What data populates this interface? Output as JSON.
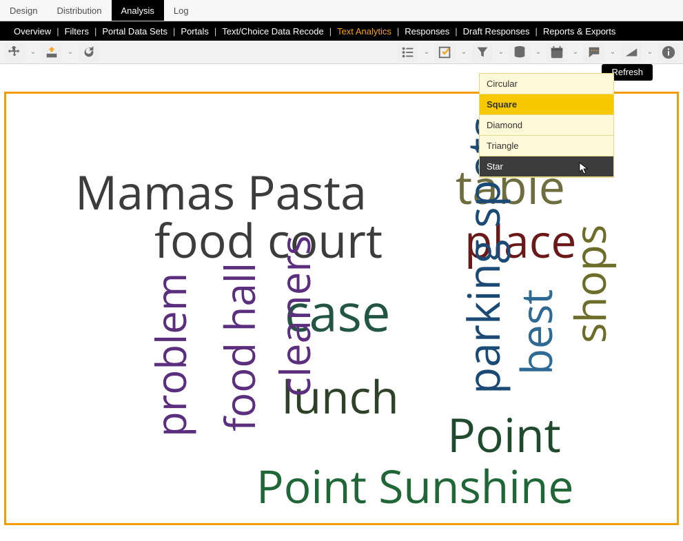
{
  "top_tabs": {
    "design": "Design",
    "distribution": "Distribution",
    "analysis": "Analysis",
    "log": "Log",
    "active": "analysis"
  },
  "subnav": {
    "overview": "Overview",
    "filters": "Filters",
    "pds": "Portal Data Sets",
    "portals": "Portals",
    "recode": "Text/Choice Data Recode",
    "ta": "Text Analytics",
    "responses": "Responses",
    "drafts": "Draft Responses",
    "reports": "Reports & Exports",
    "active": "ta"
  },
  "refresh": "Refresh",
  "shape_menu": {
    "circular": "Circular",
    "square": "Square",
    "diamond": "Diamond",
    "triangle": "Triangle",
    "star": "Star"
  },
  "toolbar_icons": {
    "move": "move-icon",
    "export": "export-icon",
    "refresh": "refresh-icon",
    "list": "list-icon",
    "check": "check-icon",
    "funnel": "funnel-icon",
    "database": "database-icon",
    "calendar": "calendar-icon",
    "chat": "chat-icon",
    "slope": "slope-icon",
    "info": "info-icon"
  },
  "wordcloud": {
    "mamas_pasta": "Mamas Pasta",
    "table": "table",
    "food_court": "food court",
    "place": "place",
    "case": "case",
    "lunch": "lunch",
    "point": "Point",
    "point_sunshine": "Point Sunshine",
    "parking_spots": "parking spots",
    "cleaners": "cleaners",
    "food_hall": "food hall",
    "problem": "problem",
    "best": "best",
    "shops": "shops"
  }
}
